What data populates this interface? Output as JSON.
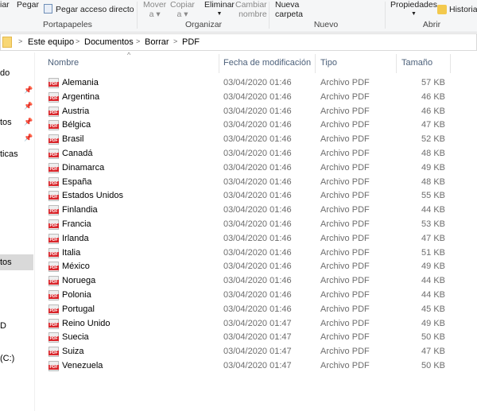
{
  "ribbon": {
    "copy_partial": "iar",
    "paste": "Pegar",
    "paste_shortcut": "Pegar acceso directo",
    "move_to": [
      "Mover",
      "a ▾"
    ],
    "copy_to": [
      "Copiar",
      "a ▾"
    ],
    "delete": "Eliminar",
    "rename": [
      "Cambiar",
      "nombre"
    ],
    "new_folder": [
      "Nueva",
      "carpeta"
    ],
    "properties": "Propiedades",
    "history": "Historia",
    "groups": {
      "clipboard": "Portapapeles",
      "organize": "Organizar",
      "new": "Nuevo",
      "open": "Abrir"
    }
  },
  "breadcrumb": [
    "Este equipo",
    "Documentos",
    "Borrar",
    "PDF"
  ],
  "sidebar": {
    "items": [
      "do",
      "tos",
      "ticas",
      "tos",
      "D",
      "(C:)"
    ]
  },
  "columns": {
    "name": "Nombre",
    "date": "Fecha de modificación",
    "type": "Tipo",
    "size": "Tamaño"
  },
  "files": [
    {
      "name": "Alemania",
      "date": "03/04/2020 01:46",
      "type": "Archivo PDF",
      "size": "57 KB"
    },
    {
      "name": "Argentina",
      "date": "03/04/2020 01:46",
      "type": "Archivo PDF",
      "size": "46 KB"
    },
    {
      "name": "Austria",
      "date": "03/04/2020 01:46",
      "type": "Archivo PDF",
      "size": "46 KB"
    },
    {
      "name": "Bélgica",
      "date": "03/04/2020 01:46",
      "type": "Archivo PDF",
      "size": "47 KB"
    },
    {
      "name": "Brasil",
      "date": "03/04/2020 01:46",
      "type": "Archivo PDF",
      "size": "52 KB"
    },
    {
      "name": "Canadá",
      "date": "03/04/2020 01:46",
      "type": "Archivo PDF",
      "size": "48 KB"
    },
    {
      "name": "Dinamarca",
      "date": "03/04/2020 01:46",
      "type": "Archivo PDF",
      "size": "49 KB"
    },
    {
      "name": "España",
      "date": "03/04/2020 01:46",
      "type": "Archivo PDF",
      "size": "48 KB"
    },
    {
      "name": "Estados Unidos",
      "date": "03/04/2020 01:46",
      "type": "Archivo PDF",
      "size": "55 KB"
    },
    {
      "name": "Finlandia",
      "date": "03/04/2020 01:46",
      "type": "Archivo PDF",
      "size": "44 KB"
    },
    {
      "name": "Francia",
      "date": "03/04/2020 01:46",
      "type": "Archivo PDF",
      "size": "53 KB"
    },
    {
      "name": "Irlanda",
      "date": "03/04/2020 01:46",
      "type": "Archivo PDF",
      "size": "47 KB"
    },
    {
      "name": "Italia",
      "date": "03/04/2020 01:46",
      "type": "Archivo PDF",
      "size": "51 KB"
    },
    {
      "name": "México",
      "date": "03/04/2020 01:46",
      "type": "Archivo PDF",
      "size": "49 KB"
    },
    {
      "name": "Noruega",
      "date": "03/04/2020 01:46",
      "type": "Archivo PDF",
      "size": "44 KB"
    },
    {
      "name": "Polonia",
      "date": "03/04/2020 01:46",
      "type": "Archivo PDF",
      "size": "44 KB"
    },
    {
      "name": "Portugal",
      "date": "03/04/2020 01:46",
      "type": "Archivo PDF",
      "size": "45 KB"
    },
    {
      "name": "Reino Unido",
      "date": "03/04/2020 01:47",
      "type": "Archivo PDF",
      "size": "49 KB"
    },
    {
      "name": "Suecia",
      "date": "03/04/2020 01:47",
      "type": "Archivo PDF",
      "size": "50 KB"
    },
    {
      "name": "Suiza",
      "date": "03/04/2020 01:47",
      "type": "Archivo PDF",
      "size": "47 KB"
    },
    {
      "name": "Venezuela",
      "date": "03/04/2020 01:47",
      "type": "Archivo PDF",
      "size": "50 KB"
    }
  ]
}
